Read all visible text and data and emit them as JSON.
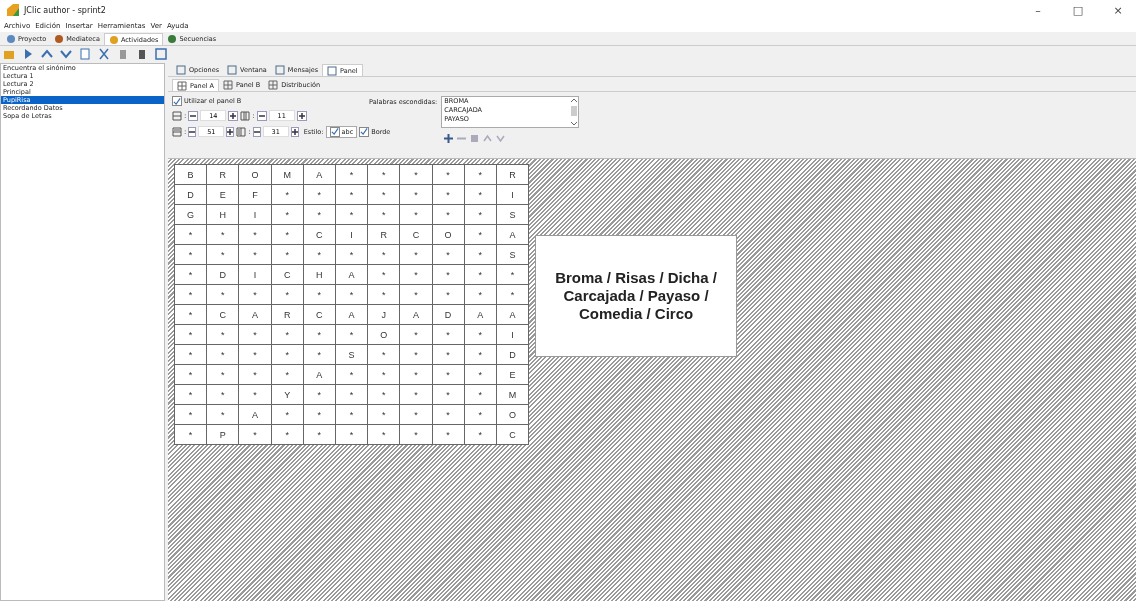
{
  "window": {
    "title": "JClic author - sprint2",
    "controls": [
      "–",
      "□",
      "×"
    ]
  },
  "menu": [
    "Archivo",
    "Edición",
    "Insertar",
    "Herramientas",
    "Ver",
    "Ayuda"
  ],
  "main_tabs": [
    {
      "label": "Proyecto",
      "selected": false
    },
    {
      "label": "Mediateca",
      "selected": false
    },
    {
      "label": "Actividades",
      "selected": true
    },
    {
      "label": "Secuencias",
      "selected": false
    }
  ],
  "activities": [
    {
      "label": "Encuentra el sinónimo",
      "selected": false
    },
    {
      "label": "Lectura 1",
      "selected": false
    },
    {
      "label": "Lectura 2",
      "selected": false
    },
    {
      "label": "Principal",
      "selected": false
    },
    {
      "label": "PupiRisa",
      "selected": true
    },
    {
      "label": "Recordando Datos",
      "selected": false
    },
    {
      "label": "Sopa de Letras",
      "selected": false
    }
  ],
  "editor_tabs": [
    {
      "label": "Opciones",
      "selected": false
    },
    {
      "label": "Ventana",
      "selected": false
    },
    {
      "label": "Mensajes",
      "selected": false
    },
    {
      "label": "Panel",
      "selected": true
    }
  ],
  "panel_tabs": [
    {
      "label": "Panel A",
      "selected": true
    },
    {
      "label": "Panel B",
      "selected": false
    },
    {
      "label": "Distribución",
      "selected": false
    }
  ],
  "use_panel_b": {
    "label": "Utilizar el panel B",
    "checked": true
  },
  "spinners": [
    {
      "kind": "rows",
      "separator": ":",
      "value": "14"
    },
    {
      "kind": "columns",
      "separator": ":",
      "value": "11"
    },
    {
      "kind": "width",
      "separator": ":",
      "value": "51"
    },
    {
      "kind": "height",
      "separator": ":",
      "value": "31"
    }
  ],
  "style": {
    "label": "Estilo:",
    "sample": "abc",
    "checked": true
  },
  "border": {
    "label": "Borde",
    "checked": true
  },
  "hidden_words": {
    "label": "Palabras escondidas:",
    "items": [
      "BROMA",
      "CARCAJADA",
      "PAYASO"
    ]
  },
  "grid": [
    [
      "B",
      "R",
      "O",
      "M",
      "A",
      "*",
      "*",
      "*",
      "*",
      "*",
      "R"
    ],
    [
      "D",
      "E",
      "F",
      "*",
      "*",
      "*",
      "*",
      "*",
      "*",
      "*",
      "I"
    ],
    [
      "G",
      "H",
      "I",
      "*",
      "*",
      "*",
      "*",
      "*",
      "*",
      "*",
      "S"
    ],
    [
      "*",
      "*",
      "*",
      "*",
      "C",
      "I",
      "R",
      "C",
      "O",
      "*",
      "A"
    ],
    [
      "*",
      "*",
      "*",
      "*",
      "*",
      "*",
      "*",
      "*",
      "*",
      "*",
      "S"
    ],
    [
      "*",
      "D",
      "I",
      "C",
      "H",
      "A",
      "*",
      "*",
      "*",
      "*",
      "*"
    ],
    [
      "*",
      "*",
      "*",
      "*",
      "*",
      "*",
      "*",
      "*",
      "*",
      "*",
      "*"
    ],
    [
      "*",
      "C",
      "A",
      "R",
      "C",
      "A",
      "J",
      "A",
      "D",
      "A",
      "A"
    ],
    [
      "*",
      "*",
      "*",
      "*",
      "*",
      "*",
      "O",
      "*",
      "*",
      "*",
      "I"
    ],
    [
      "*",
      "*",
      "*",
      "*",
      "*",
      "S",
      "*",
      "*",
      "*",
      "*",
      "D"
    ],
    [
      "*",
      "*",
      "*",
      "*",
      "A",
      "*",
      "*",
      "*",
      "*",
      "*",
      "E"
    ],
    [
      "*",
      "*",
      "*",
      "Y",
      "*",
      "*",
      "*",
      "*",
      "*",
      "*",
      "M"
    ],
    [
      "*",
      "*",
      "A",
      "*",
      "*",
      "*",
      "*",
      "*",
      "*",
      "*",
      "O"
    ],
    [
      "*",
      "P",
      "*",
      "*",
      "*",
      "*",
      "*",
      "*",
      "*",
      "*",
      "C"
    ]
  ],
  "clue": "Broma / Risas / Dicha / Carcajada / Payaso / Comedia / Circo"
}
